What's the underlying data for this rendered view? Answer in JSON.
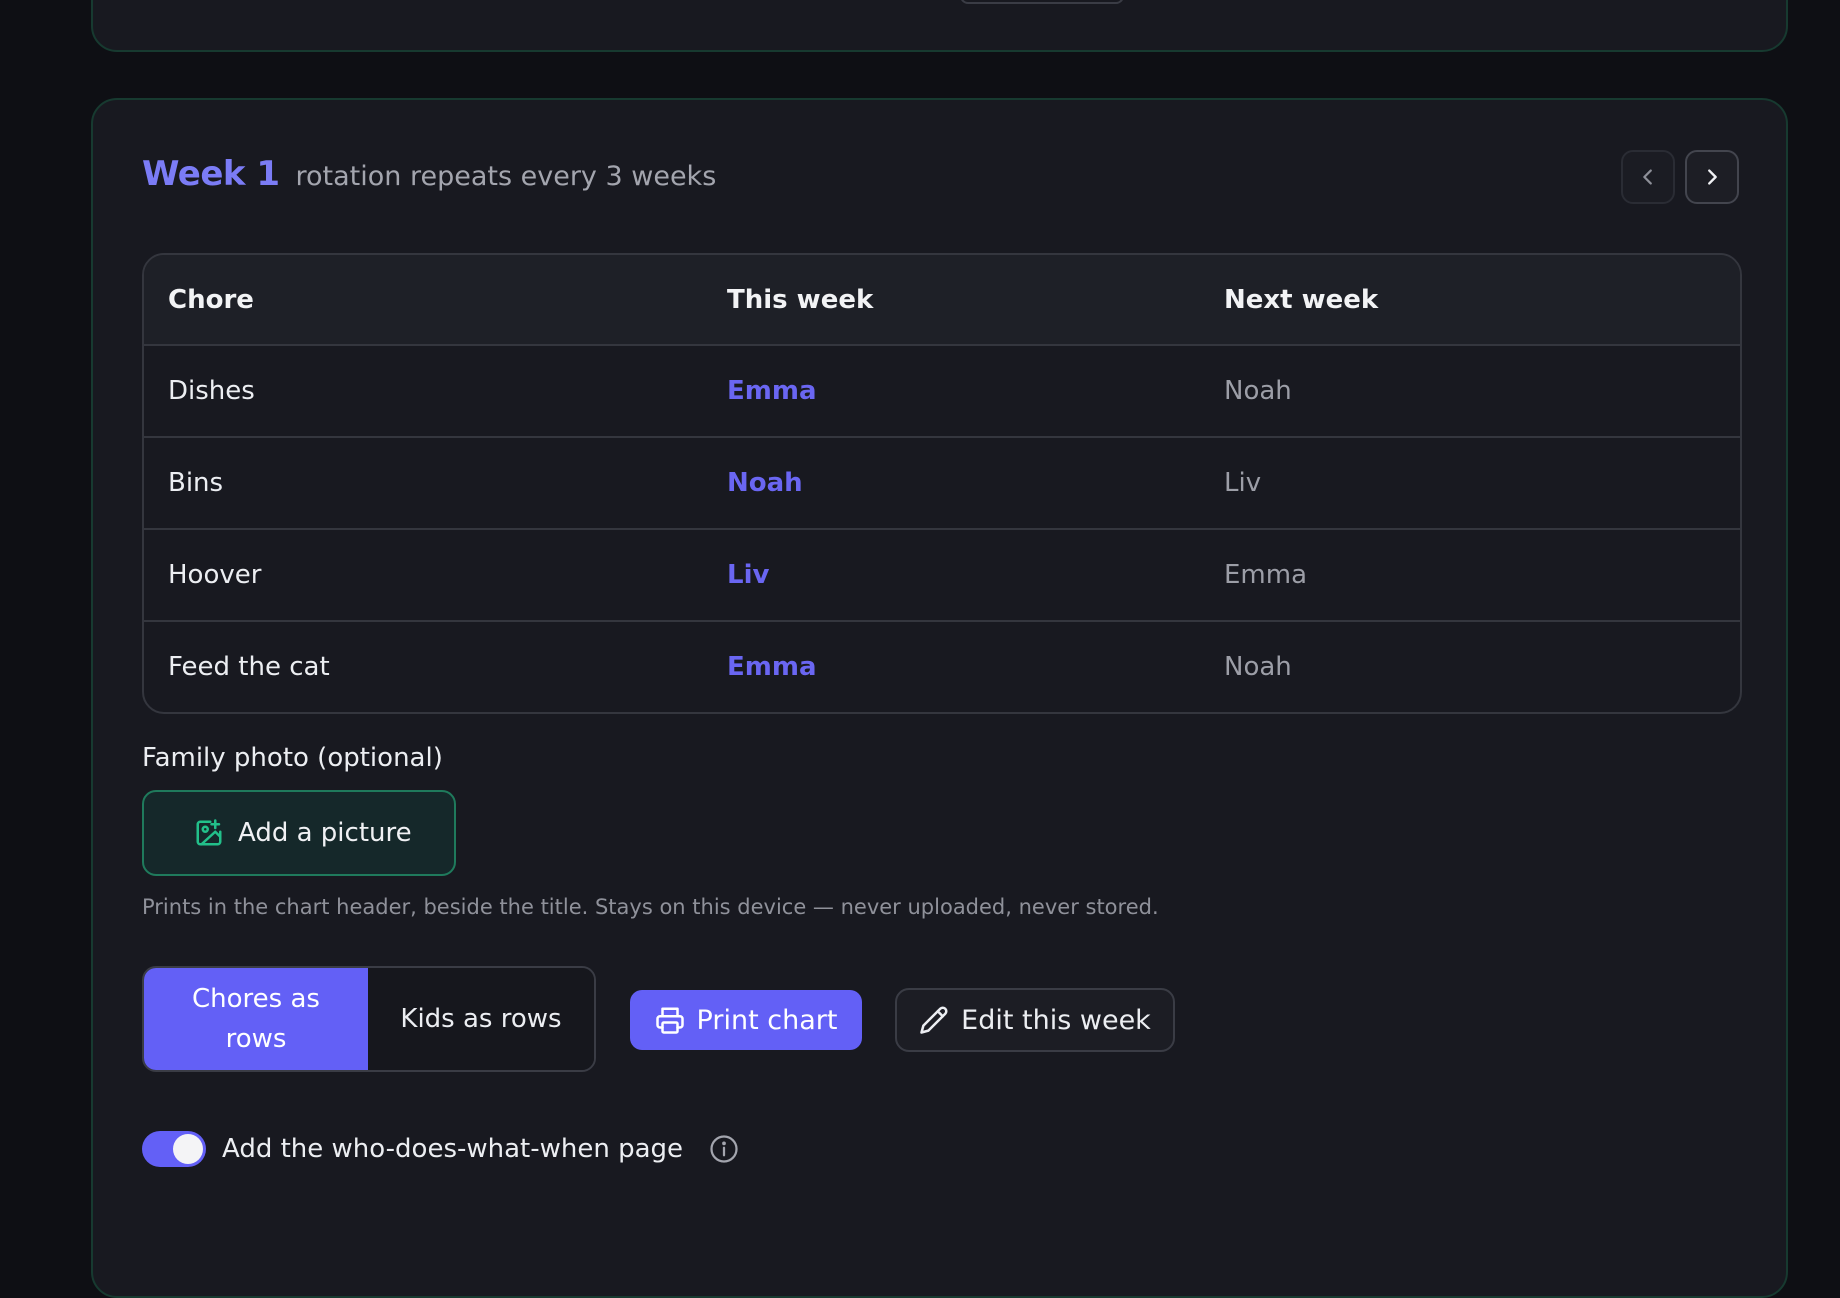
{
  "colors": {
    "background": "#0e0f14",
    "card": "#181920",
    "card_border": "#173a30",
    "accent": "#6360f6",
    "accent_text": "#6a66f2",
    "green_border": "#1f7a5c"
  },
  "week": {
    "title": "Week 1",
    "subtitle": "rotation repeats every 3 weeks",
    "prev_icon": "chevron-left-icon",
    "next_icon": "chevron-right-icon"
  },
  "table": {
    "headers": [
      "Chore",
      "This week",
      "Next week"
    ],
    "rows": [
      {
        "chore": "Dishes",
        "this_week": "Emma",
        "next_week": "Noah"
      },
      {
        "chore": "Bins",
        "this_week": "Noah",
        "next_week": "Liv"
      },
      {
        "chore": "Hoover",
        "this_week": "Liv",
        "next_week": "Emma"
      },
      {
        "chore": "Feed the cat",
        "this_week": "Emma",
        "next_week": "Noah"
      }
    ]
  },
  "photo": {
    "label": "Family photo (optional)",
    "button_label": "Add a picture",
    "button_icon": "image-add-icon",
    "hint": "Prints in the chart header, beside the title. Stays on this device — never uploaded, never stored."
  },
  "layout_toggle": {
    "option_a": "Chores as rows",
    "option_b": "Kids as rows",
    "selected": "Chores as rows"
  },
  "actions": {
    "print_label": "Print chart",
    "print_icon": "printer-icon",
    "edit_label": "Edit this week",
    "edit_icon": "pencil-icon"
  },
  "schedule_page": {
    "label": "Add the who-does-what-when page",
    "enabled": true,
    "info_icon": "info-icon"
  }
}
